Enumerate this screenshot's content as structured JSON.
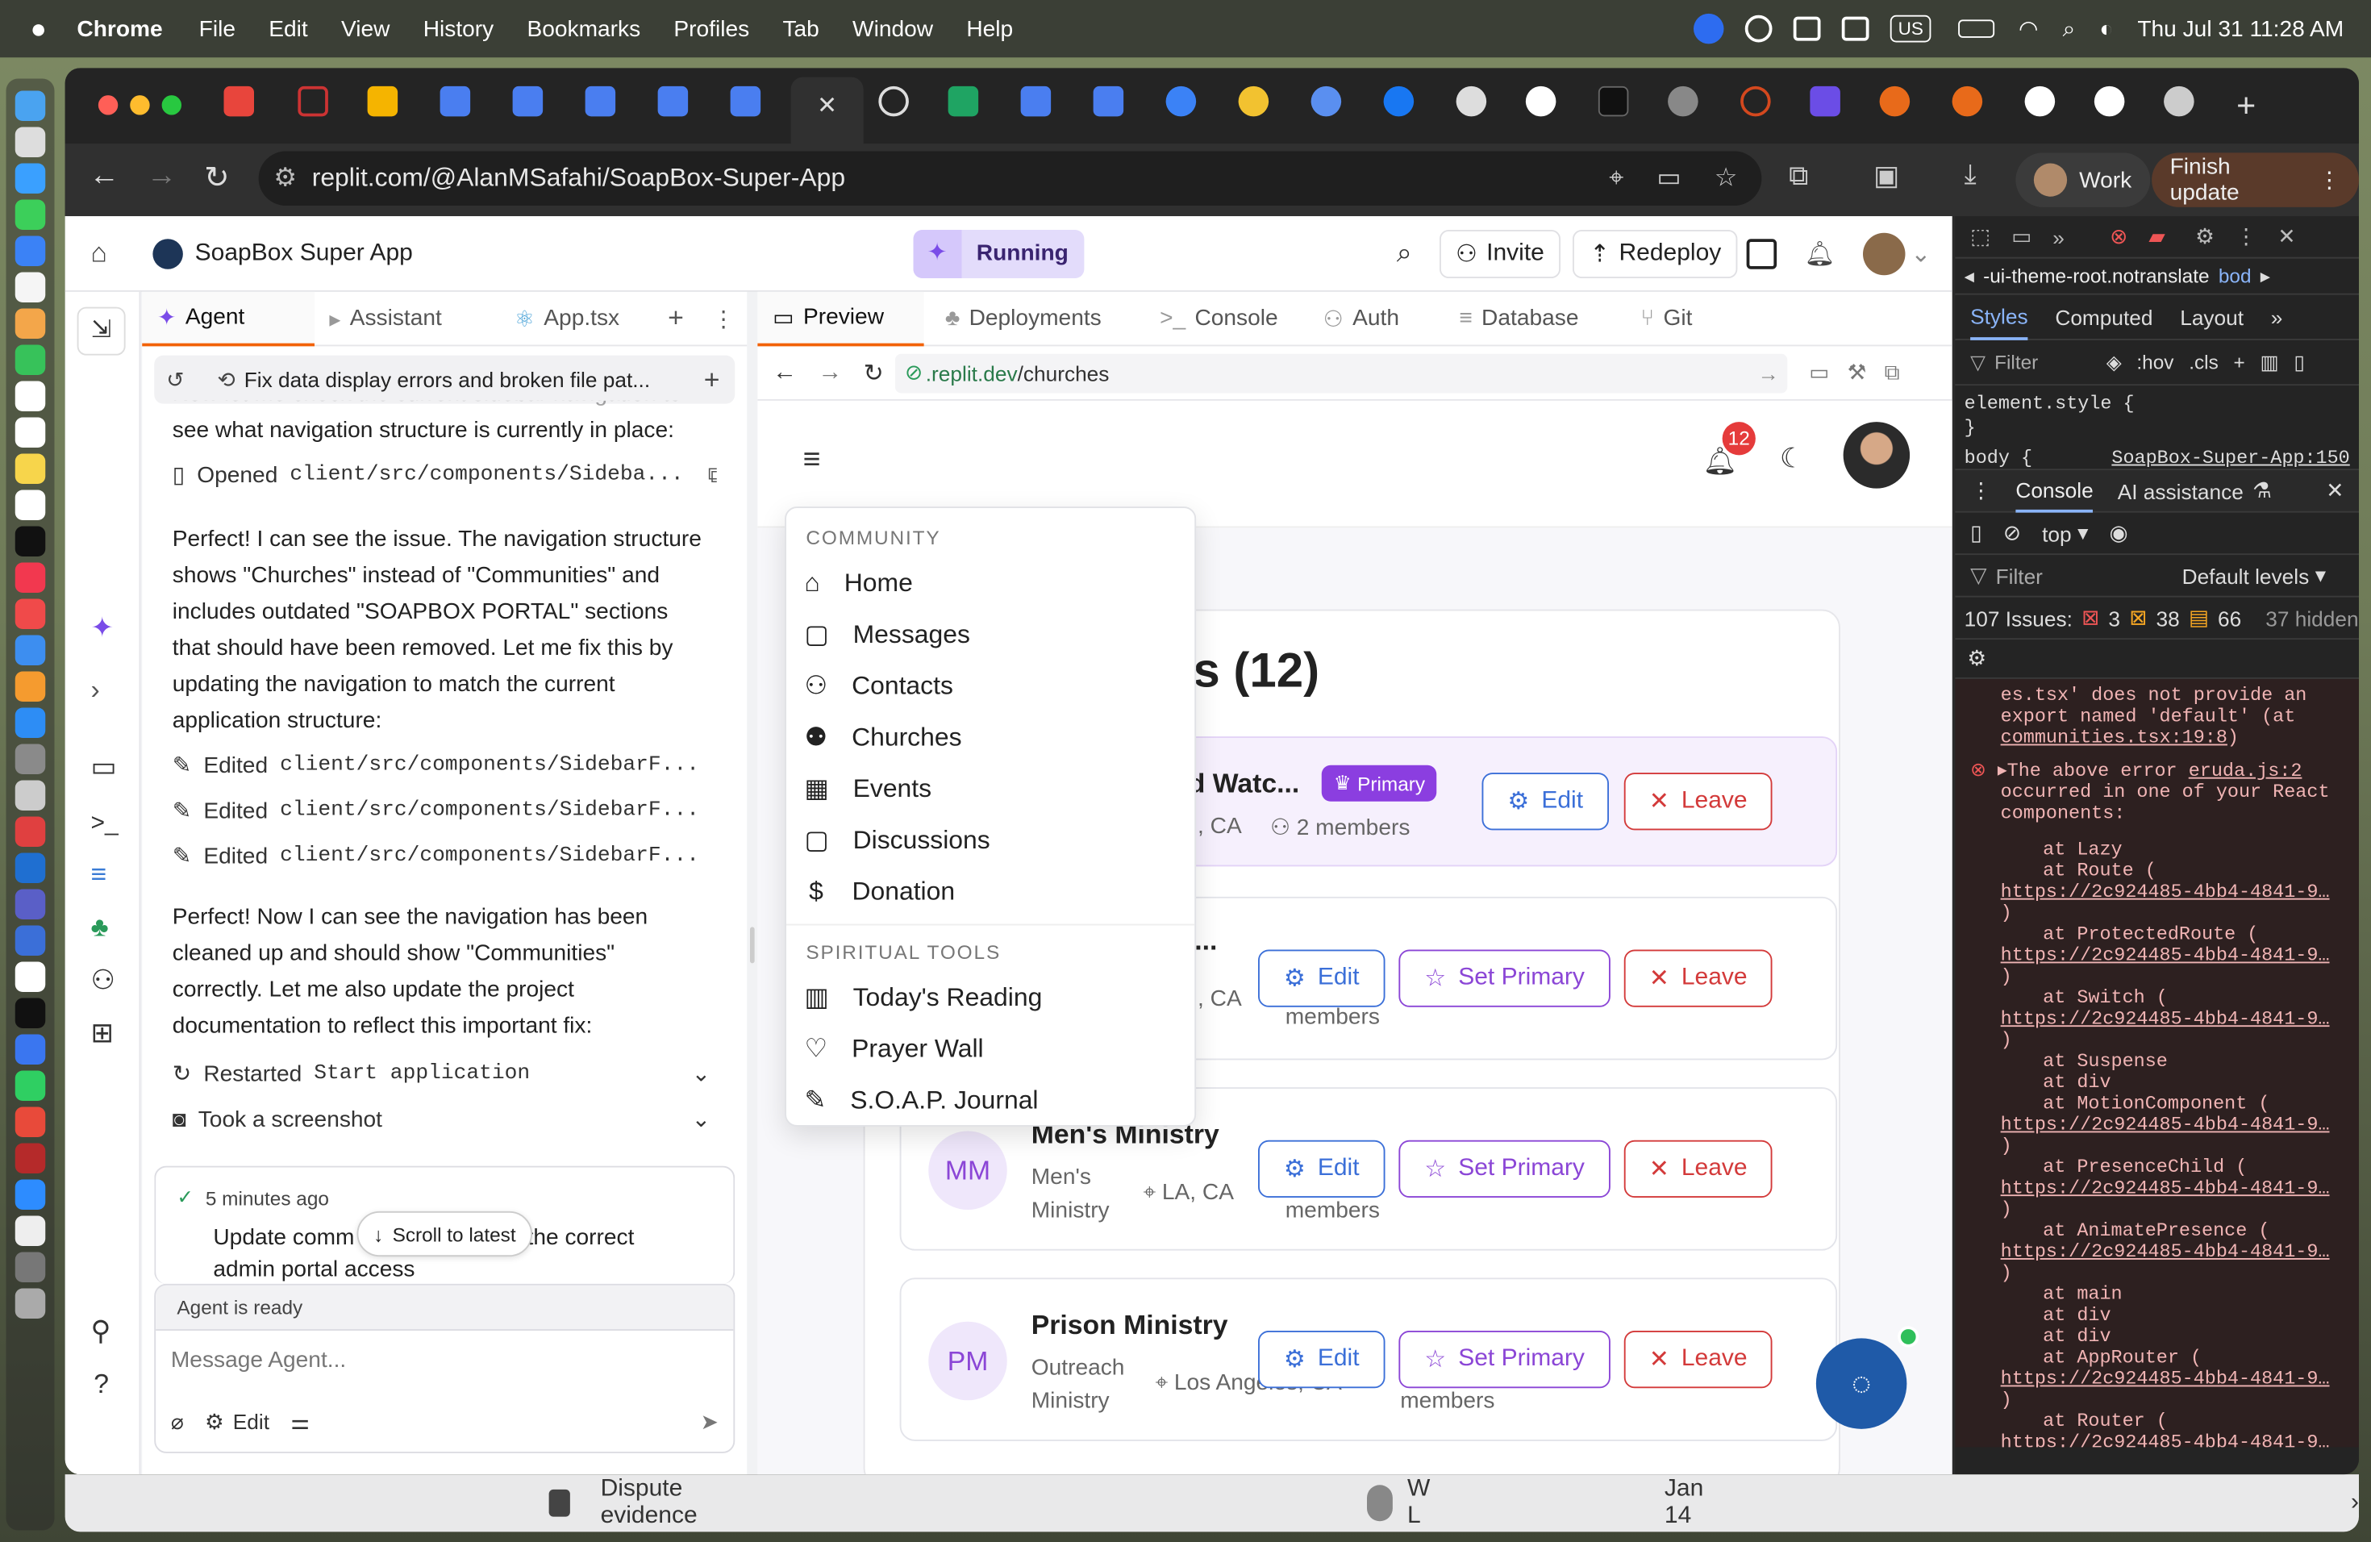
{
  "menubar": {
    "app": "Chrome",
    "items": [
      "File",
      "Edit",
      "View",
      "History",
      "Bookmarks",
      "Profiles",
      "Tab",
      "Window",
      "Help"
    ],
    "clock": "Thu Jul 31  11:28 AM",
    "input_source": "US"
  },
  "browser": {
    "url": "replit.com/@AlanMSafahi/SoapBox-Super-App",
    "profile": "Work",
    "update_label": "Finish update"
  },
  "app": {
    "title": "SoapBox Super App",
    "status": "Running",
    "invite": "Invite",
    "redeploy": "Redeploy"
  },
  "agent": {
    "tabs": [
      "Agent",
      "Assistant",
      "App.tsx"
    ],
    "thread_title": "Fix data display errors and broken file pat...",
    "faded_text": "Now let me check the current sidebar navigation to",
    "line1": "see what navigation structure is currently in place:",
    "opened": "Opened",
    "opened_file": "client/src/components/Sideba...",
    "para1": "Perfect! I can see the issue. The navigation structure shows \"Churches\" instead of \"Communities\" and includes outdated \"SOAPBOX PORTAL\" sections that should have been removed. Let me fix this by updating the navigation to match the current application structure:",
    "edited": "Edited",
    "edited_files": [
      "client/src/components/SidebarF...",
      "client/src/components/SidebarF...",
      "client/src/components/SidebarF..."
    ],
    "para2": "Perfect! Now I can see the navigation has been cleaned up and should show \"Communities\" correctly. Let me also update the project documentation to reflect this important fix:",
    "restarted": "Restarted",
    "restarted_name": "Start application",
    "screenshot": "Took a screenshot",
    "checkpoint_time": "5 minutes ago",
    "checkpoint_text_a": "Update comm",
    "checkpoint_text_b": "ect the correct",
    "checkpoint_text_c": "admin portal access",
    "scroll_latest": "Scroll to latest",
    "ready": "Agent is ready",
    "input_placeholder": "Message Agent...",
    "edit_label": "Edit"
  },
  "preview": {
    "tabs": [
      "Preview",
      "Deployments",
      "Console",
      "Auth",
      "Database",
      "Git"
    ],
    "url_host": ".replit.dev",
    "url_path": "/churches",
    "notif_count": "12",
    "heading": "s (12)",
    "cards": [
      {
        "name": "d Watc...",
        "loc": ", CA",
        "members": "2 members",
        "badge": "Primary"
      },
      {
        "name": "...",
        "loc": ", CA",
        "members": "members"
      },
      {
        "initials": "MM",
        "name": "Men's Ministry",
        "sub1": "Men's",
        "sub2": "Ministry",
        "loc": "LA, CA",
        "members": "members"
      },
      {
        "initials": "PM",
        "name": "Prison Ministry",
        "sub1": "Outreach",
        "sub2": "Ministry",
        "loc": "Los Angeles, CA",
        "members": "members"
      }
    ],
    "btn_edit": "Edit",
    "btn_primary": "Set Primary",
    "btn_leave": "Leave"
  },
  "dropdown": {
    "community_header": "COMMUNITY",
    "community": [
      "Home",
      "Messages",
      "Contacts",
      "Churches",
      "Events",
      "Discussions",
      "Donation"
    ],
    "tools_header": "SPIRITUAL TOOLS",
    "tools": [
      "Today's Reading",
      "Prayer Wall",
      "S.O.A.P. Journal"
    ]
  },
  "devtools": {
    "crumb1": "-ui-theme-root.notranslate",
    "crumb2": "bod",
    "tabs": [
      "Styles",
      "Computed",
      "Layout"
    ],
    "filter": "Filter",
    "hov": ":hov",
    "cls": ".cls",
    "rule1": "element.style {",
    "rule1_end": "}",
    "rule2": "body {",
    "rule2_src": "SoapBox-Super-App:150",
    "drawer_tabs": [
      "Console",
      "AI assistance"
    ],
    "context": "top",
    "levels": "Default levels",
    "issues": "107 Issues:",
    "i_err": "3",
    "i_warn": "38",
    "i_info": "66",
    "hidden": "37 hidden",
    "log_a": "es.tsx' does not provide an export named 'default' (at",
    "log_a_link": "communities.tsx:19:8",
    "log_a_end": ")",
    "err_head": "The above error",
    "err_link": "eruda.js:2",
    "err_body": "occurred in one of your React components:",
    "stack_link": "https://2c924485-4bb4-4841-9…",
    "stack": [
      "at Lazy",
      "at Route (",
      "at ProtectedRoute (",
      "at Switch (",
      "at Suspense",
      "at div",
      "at MotionComponent (",
      "at PresenceChild (",
      "at AnimatePresence (",
      "at main",
      "at div",
      "at div",
      "at AppRouter (",
      "at Router ("
    ]
  },
  "background": {
    "text": "Dispute evidence",
    "user": "W L",
    "date": "Jan 14"
  }
}
